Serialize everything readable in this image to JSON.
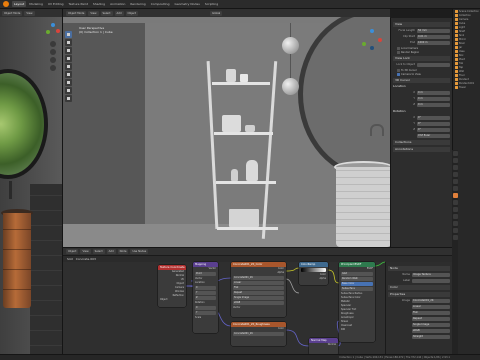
{
  "app": {
    "tabs": [
      "Layout",
      "Modeling",
      "UV Editing",
      "Texture Paint",
      "Shading",
      "Animation",
      "Rendering",
      "Compositing",
      "Geometry Nodes",
      "Scripting"
    ],
    "active_tab": "Layout"
  },
  "left_view": {
    "header": {
      "mode": "Object Mode",
      "view": "View"
    }
  },
  "main_view": {
    "header": {
      "mode": "Object Mode",
      "menu_view": "View",
      "menu_select": "Select",
      "menu_add": "Add",
      "menu_object": "Object",
      "transform": "Global"
    },
    "info_line1": "User Perspective",
    "info_line2": "(0) Collection 1 | Cube"
  },
  "npanel": {
    "view_header": "View",
    "focal_length_label": "Focal Length",
    "focal_length_value": "50 mm",
    "clip_start_label": "Clip Start",
    "clip_start_value": "0.01 m",
    "clip_end_label": "End",
    "clip_end_value": "1000 m",
    "local_camera_label": "Local Camera",
    "render_region_label": "Render Region",
    "view_lock_header": "View Lock",
    "lock_to_object_label": "Lock to Object",
    "lock_label": "Lock",
    "lock_cursor": "To 3D Cursor",
    "lock_camera": "Camera to View",
    "cursor_header": "3D Cursor",
    "location_label": "Location",
    "x_value": "0 m",
    "y_value": "0 m",
    "z_value": "0 m",
    "rotation_label": "Rotation",
    "rx_value": "0°",
    "ry_value": "0°",
    "rz_value": "0°",
    "mode_value": "XYZ Euler",
    "collections_header": "Collections",
    "annotations_header": "Annotations"
  },
  "node_editor": {
    "header": {
      "editor": "Object",
      "view": "View",
      "select": "Select",
      "add": "Add",
      "node": "Node",
      "use_nodes": "Use Nodes"
    },
    "subheader": {
      "slot": "Slot",
      "material": "Concrete.003"
    },
    "nodes": {
      "texcoord": {
        "title": "Texture Coordinate",
        "rows": [
          "Generated",
          "Normal",
          "UV",
          "Object",
          "Camera",
          "Window",
          "Reflection"
        ],
        "object_label": "Object",
        "from_instancer": "From Instancer"
      },
      "mapping": {
        "title": "Mapping",
        "type": "Point",
        "rows": [
          "Vector",
          "Location",
          "Rotation",
          "Scale"
        ],
        "x_label": "X",
        "y_label": "Y",
        "z_label": "Z"
      },
      "image1": {
        "title": "Concrete001_2K_Color",
        "rows": [
          "Color",
          "Alpha"
        ],
        "file": "Concrete001_2K",
        "opt1": "Linear",
        "opt2": "Flat",
        "opt3": "Repeat",
        "opt4": "Single Image",
        "opt5": "Color Space",
        "opt6": "Alpha",
        "opt7": "sRGB",
        "opt8": "Straight",
        "vector": "Vector"
      },
      "image2": {
        "title": "Concrete001_2K_Roughness",
        "rows": [
          "Color",
          "Alpha"
        ],
        "file": "Concrete001_2K"
      },
      "colorramp": {
        "title": "ColorRamp",
        "rows": [
          "Color",
          "Alpha",
          "Fac"
        ]
      },
      "bsdf": {
        "title": "Principled BSDF",
        "rows": [
          "BSDF",
          "GGX",
          "Random Walk",
          "Base Color",
          "Subsurface",
          "Subsurface Radius",
          "Subsurface Color",
          "Metallic",
          "Specular",
          "Specular Tint",
          "Roughness",
          "Anisotropic",
          "Sheen",
          "Clearcoat",
          "IOR",
          "Normal"
        ]
      },
      "normalmap": {
        "title": "Normal Map",
        "rows": [
          "Normal",
          "Tangent Space",
          "UV Map",
          "Strength",
          "Color"
        ]
      }
    },
    "sidepanel": {
      "header": "Node",
      "name_label": "Name",
      "name_value": "Image Texture",
      "label_label": "Label",
      "color_header": "Color",
      "properties_header": "Properties",
      "image_label": "Image",
      "image_value": "Concrete001_2K",
      "opt_linear": "Linear",
      "opt_flat": "Flat",
      "opt_repeat": "Repeat",
      "source_value": "Single Image",
      "colorspace_value": "sRGB",
      "alpha_value": "Straight"
    }
  },
  "outliner": {
    "rows": [
      "Scene Collection",
      "Collection",
      "Camera",
      "Cube",
      "Light",
      "Shelf",
      "Sink",
      "Mirror",
      "Bowl",
      "Jar",
      "Vase",
      "Box",
      "Plant",
      "Tub",
      "Tap",
      "Wall",
      "Floor",
      "Pendant",
      "Pendant.001",
      "Towel"
    ]
  },
  "status": {
    "text": "Collection 1 | Cube | Verts:190,131 | Faces:186,072 | Tris:372,144 | Objects:1/26 | 2.93.1"
  },
  "colors": {
    "accent": "#e87d0d",
    "selection_blue": "#4772b3",
    "node_image_header": "#a8562c",
    "node_input_header": "#b1302f",
    "node_vector_header": "#5a3f8f",
    "node_shader_header": "#2e7a4e",
    "node_converter_header": "#3f6a8f",
    "socket_yellow": "#c7c729",
    "socket_purple": "#6363c7",
    "socket_grey": "#a1a1a1",
    "socket_green": "#3ec83e"
  }
}
